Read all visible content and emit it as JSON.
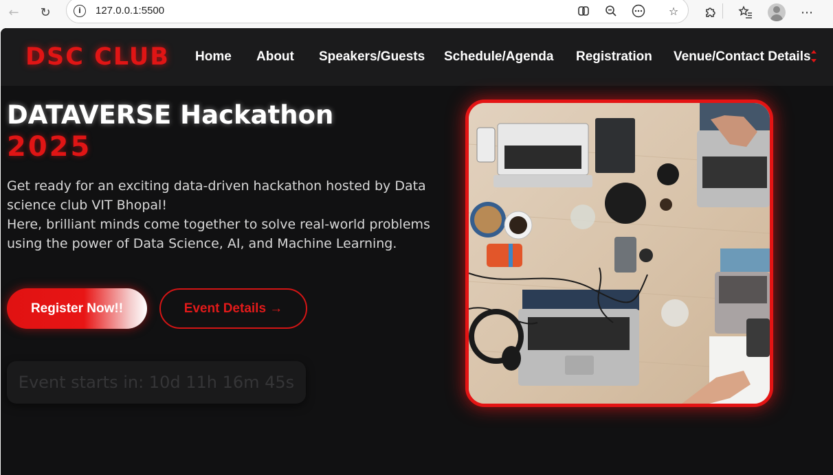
{
  "browser": {
    "url": "127.0.0.1:5500"
  },
  "header": {
    "logo": "DSC CLUB",
    "nav": [
      {
        "label": "Home"
      },
      {
        "label": "About"
      },
      {
        "label": "Speakers/Guests"
      },
      {
        "label": "Schedule/Agenda"
      },
      {
        "label": "Registration"
      },
      {
        "label": "Venue/Contact Details"
      }
    ]
  },
  "hero": {
    "title": "DATAVERSE Hackathon",
    "year": "2025",
    "description_line1": "Get ready for an exciting data-driven hackathon hosted by Data science club VIT Bhopal!",
    "description_line2": "Here, brilliant minds come together to solve real-world problems using the power of Data Science, AI, and Machine Learning.",
    "register_label": "Register Now!!",
    "details_label": "Event Details →",
    "countdown": "Event starts in: 10d 11h 16m 45s"
  },
  "colors": {
    "accent": "#e01515",
    "background": "#111112",
    "header_bg": "#1b1b1c"
  },
  "icons": {
    "back": "arrow-left-icon",
    "reload": "reload-icon",
    "site_info": "info-icon",
    "copilot": "copilot-icon",
    "zoom": "zoom-out-icon",
    "more_addr": "ellipsis-icon",
    "favorite": "star-icon",
    "extensions": "puzzle-icon",
    "favorites": "favorites-list-icon",
    "profile": "avatar-icon",
    "menu": "more-menu-icon"
  }
}
